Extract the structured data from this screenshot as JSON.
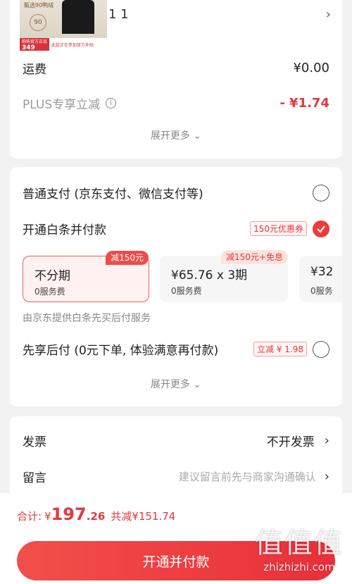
{
  "product": {
    "qty_text": "1 1",
    "banner_top": "甄选90鸭绒",
    "banner_mid": "90",
    "banner_price": "349",
    "banner_tag": "购购官方正品",
    "banner_note": "此款正在参加官方补贴"
  },
  "fees": {
    "shipping_label": "运费",
    "shipping_value": "¥0.00",
    "plus_label": "PLUS专享立减",
    "plus_value": "- ¥1.74",
    "expand": "展开更多"
  },
  "payment": {
    "normal_label": "普通支付 (京东支付、微信支付等)",
    "baitiao_label": "开通白条并付款",
    "baitiao_tag": "150元优惠券",
    "plans": [
      {
        "badge": "减150元",
        "title": "不分期",
        "fee": "0服务费"
      },
      {
        "badge": "减150元+免息",
        "title": "¥65.76 x 3期",
        "fee": "0服务费"
      },
      {
        "badge": "",
        "title": "¥32",
        "fee": "0服务"
      }
    ],
    "provider_note": "由京东提供白条先买后付服务",
    "later_label": "先享后付 (0元下单, 体验满意再付款)",
    "later_tag": "立减 ¥ 1.98",
    "expand": "展开更多"
  },
  "extra": {
    "invoice_label": "发票",
    "invoice_value": "不开发票",
    "message_label": "留言",
    "message_placeholder": "建议留言前先与商家沟通确认"
  },
  "footer": {
    "total_label": "合计:",
    "currency": "¥",
    "total_int": "197",
    "total_dec": ".26",
    "saved": "共减¥151.74",
    "submit": "开通并付款"
  },
  "watermark": {
    "big": "值值值",
    "small": "zhizhizhi.com"
  },
  "colors": {
    "accent": "#e4393c",
    "button": "#ee3b3b"
  }
}
